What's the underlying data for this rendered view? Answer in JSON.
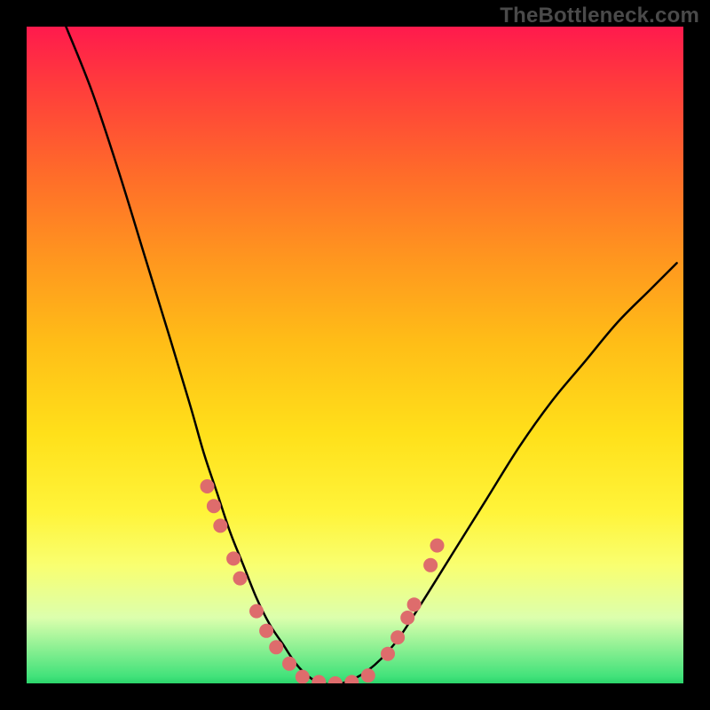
{
  "watermark": "TheBottleneck.com",
  "chart_data": {
    "type": "line",
    "title": "",
    "xlabel": "",
    "ylabel": "",
    "xlim": [
      0,
      100
    ],
    "ylim": [
      0,
      100
    ],
    "grid": false,
    "legend": false,
    "series": [
      {
        "name": "bottleneck-curve",
        "x": [
          6,
          10,
          14,
          18,
          22,
          25,
          27,
          29,
          31,
          33,
          35,
          37,
          39,
          41,
          43,
          45,
          48,
          52,
          56,
          60,
          65,
          70,
          75,
          80,
          85,
          90,
          95,
          99
        ],
        "y": [
          100,
          90,
          78,
          65,
          52,
          42,
          35,
          29,
          23,
          18,
          13,
          9,
          6,
          3,
          1,
          0,
          0,
          2,
          6,
          12,
          20,
          28,
          36,
          43,
          49,
          55,
          60,
          64
        ],
        "color": "#000000",
        "stroke_width": 2.5
      }
    ],
    "markers": [
      {
        "name": "left-branch-markers",
        "shape": "circle",
        "color": "#de6c6c",
        "radius": 8,
        "points": [
          {
            "x": 27.5,
            "y": 30
          },
          {
            "x": 28.5,
            "y": 27
          },
          {
            "x": 29.5,
            "y": 24
          },
          {
            "x": 31.5,
            "y": 19
          },
          {
            "x": 32.5,
            "y": 16
          },
          {
            "x": 35.0,
            "y": 11
          },
          {
            "x": 36.5,
            "y": 8
          },
          {
            "x": 38.0,
            "y": 5.5
          },
          {
            "x": 40.0,
            "y": 3
          }
        ]
      },
      {
        "name": "valley-markers",
        "shape": "circle",
        "color": "#de6c6c",
        "radius": 8,
        "points": [
          {
            "x": 42.0,
            "y": 1
          },
          {
            "x": 44.5,
            "y": 0.2
          },
          {
            "x": 47.0,
            "y": 0
          },
          {
            "x": 49.5,
            "y": 0.2
          },
          {
            "x": 52.0,
            "y": 1.2
          }
        ]
      },
      {
        "name": "right-branch-markers",
        "shape": "circle",
        "color": "#de6c6c",
        "radius": 8,
        "points": [
          {
            "x": 55.0,
            "y": 4.5
          },
          {
            "x": 56.5,
            "y": 7
          },
          {
            "x": 58.0,
            "y": 10
          },
          {
            "x": 59.0,
            "y": 12
          },
          {
            "x": 61.5,
            "y": 18
          },
          {
            "x": 62.5,
            "y": 21
          }
        ]
      }
    ]
  }
}
